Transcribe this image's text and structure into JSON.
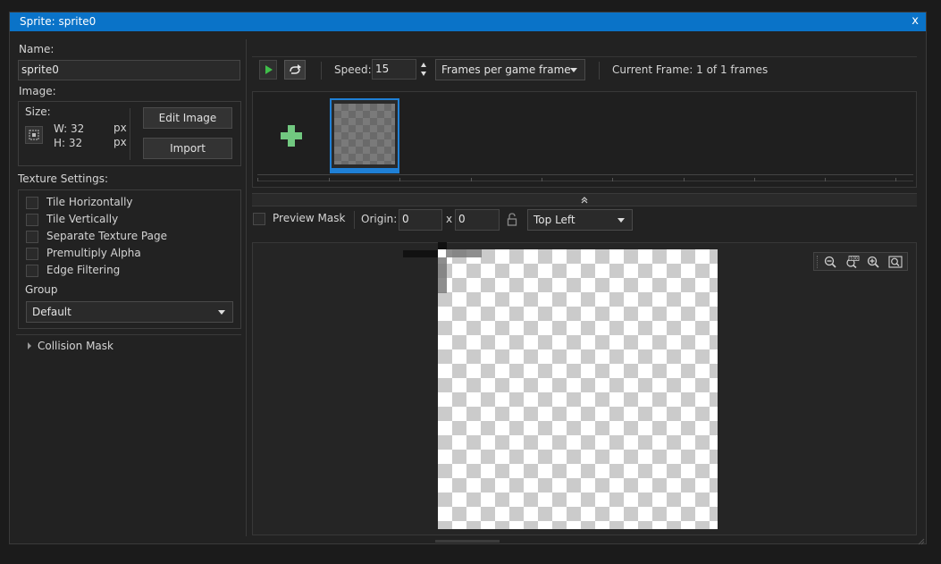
{
  "window": {
    "title": "Sprite: sprite0",
    "close_label": "x"
  },
  "left": {
    "name_label": "Name:",
    "name_value": "sprite0",
    "image_label": "Image:",
    "size_label": "Size:",
    "width_label": "W: 32",
    "height_label": "H: 32",
    "px_unit": "px",
    "edit_image_button": "Edit Image",
    "import_button": "Import",
    "texture_settings_label": "Texture Settings:",
    "checkboxes": [
      "Tile Horizontally",
      "Tile Vertically",
      "Separate Texture Page",
      "Premultiply Alpha",
      "Edge Filtering"
    ],
    "group_label": "Group",
    "group_value": "Default",
    "collision_mask_label": "Collision Mask"
  },
  "toolbar": {
    "speed_label": "Speed:",
    "speed_value": "15",
    "speed_mode": "Frames per game frame",
    "current_frame_text": "Current Frame: 1 of 1 frames"
  },
  "origin_bar": {
    "preview_mask_label": "Preview Mask",
    "origin_label": "Origin:",
    "origin_x": "0",
    "origin_sep": "x",
    "origin_y": "0",
    "origin_mode": "Top Left"
  },
  "colors": {
    "titlebar": "#0a73c8",
    "selected_frame": "#1f80d6",
    "add_frame": "#71c880",
    "play_icon": "#3fbf4a"
  }
}
